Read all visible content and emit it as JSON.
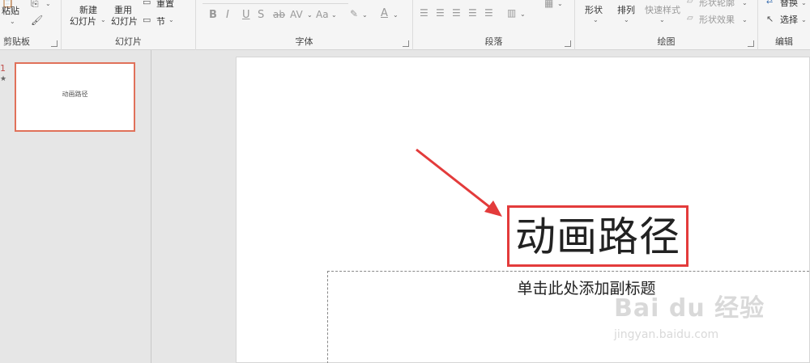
{
  "ribbon": {
    "clipboard": {
      "paste": "粘贴",
      "label": "剪贴板"
    },
    "slides": {
      "new_slide_1": "新建",
      "new_slide_2": "幻灯片",
      "reuse_1": "重用",
      "reuse_2": "幻灯片",
      "reset": "重置",
      "section": "节",
      "label": "幻灯片"
    },
    "font": {
      "bold": "B",
      "italic": "I",
      "underline": "U",
      "shadow": "S",
      "strike": "ab",
      "spacing": "AV",
      "case": "Aa",
      "font_color": "A",
      "label": "字体"
    },
    "paragraph": {
      "label": "段落"
    },
    "drawing": {
      "shapes": "形状",
      "arrange": "排列",
      "quick_styles": "快速样式",
      "shape_outline": "形状轮廓",
      "shape_effects": "形状效果",
      "label": "绘图"
    },
    "editing": {
      "replace": "替换",
      "select": "选择",
      "label": "编辑"
    }
  },
  "thumbnails": [
    {
      "number": "1",
      "star": "★",
      "title": "动画路径"
    }
  ],
  "slide": {
    "title": "动画路径",
    "subtitle": "单击此处添加副标题"
  },
  "watermark": {
    "main": "Bai du 经验",
    "sub": "jingyan.baidu.com"
  },
  "colors": {
    "accent": "#e33b3b",
    "thumb_border": "#e0715a"
  }
}
